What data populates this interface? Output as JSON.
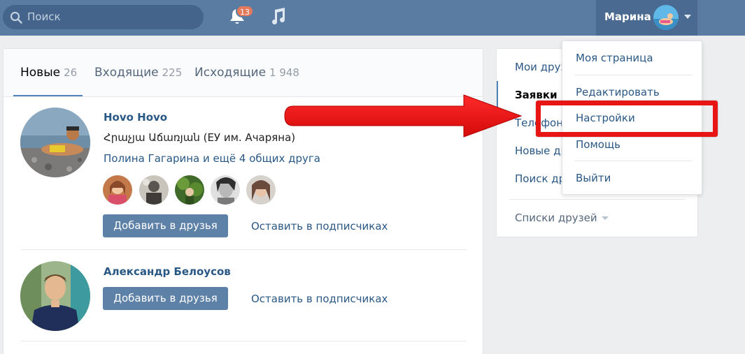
{
  "header": {
    "search_placeholder": "Поиск",
    "notifications_count": "13",
    "user_name": "Марина"
  },
  "tabs": [
    {
      "label": "Новые",
      "count": "26"
    },
    {
      "label": "Входящие",
      "count": "225"
    },
    {
      "label": "Исходящие",
      "count": "1 948"
    }
  ],
  "requests": [
    {
      "name": "Hovo Hovo",
      "education": "Հրաչյա Աճառյան (ЕУ им. Ачаряна)",
      "mutual": "Полина Гагарина и ещё 4 общих друга",
      "add_label": "Добавить в друзья",
      "keep_label": "Оставить в подписчиках"
    },
    {
      "name": "Александр Белоусов",
      "add_label": "Добавить в друзья",
      "keep_label": "Оставить в подписчиках"
    }
  ],
  "right_menu": {
    "items": [
      "Мои друз",
      "Заявки в",
      "Телефонн",
      "Новые др",
      "Поиск др"
    ],
    "lists_label": "Списки друзей"
  },
  "dropdown": {
    "items": [
      "Моя страница",
      "Редактировать",
      "Настройки",
      "Помощь",
      "Выйти"
    ]
  },
  "colors": {
    "header_bg": "#5a7ca3",
    "accent": "#5181b8",
    "button": "#5e81a8",
    "highlight": "#e81515",
    "badge": "#e6785b"
  }
}
